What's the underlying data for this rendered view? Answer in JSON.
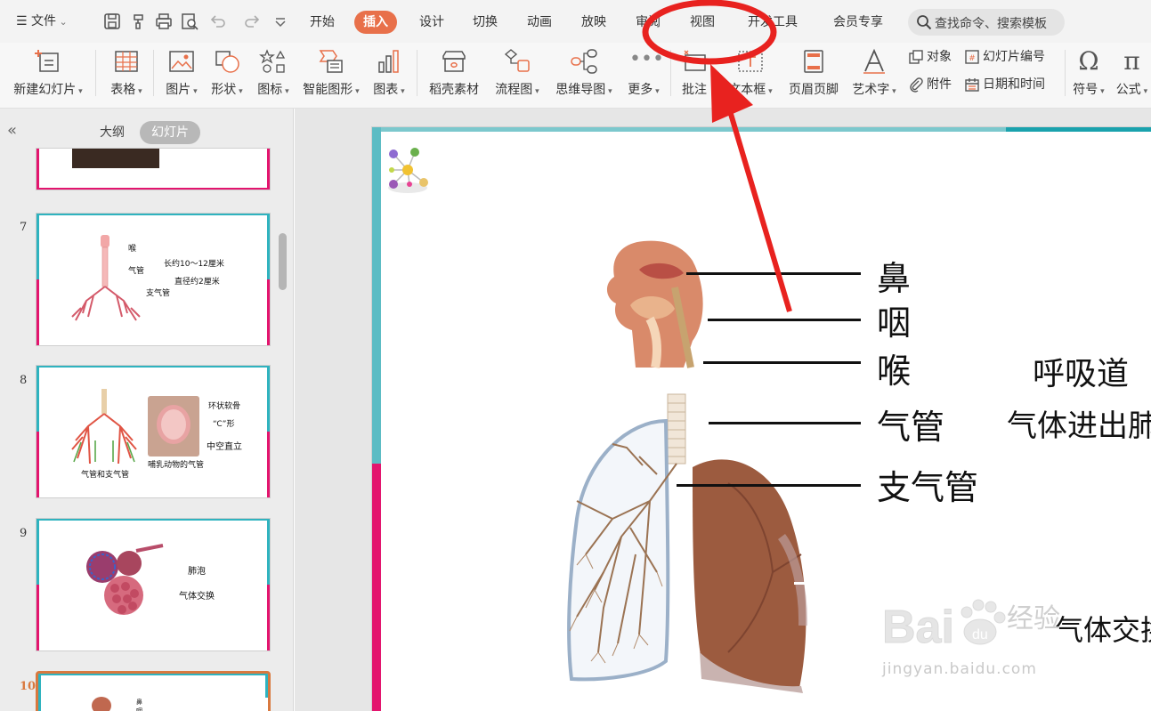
{
  "menubar": {
    "file_label": "文件",
    "tabs": [
      {
        "label": "开始",
        "active": false
      },
      {
        "label": "插入",
        "active": true
      },
      {
        "label": "设计",
        "active": false
      },
      {
        "label": "切换",
        "active": false
      },
      {
        "label": "动画",
        "active": false
      },
      {
        "label": "放映",
        "active": false
      },
      {
        "label": "审阅",
        "active": false
      },
      {
        "label": "视图",
        "active": false
      },
      {
        "label": "开发工具",
        "active": false
      },
      {
        "label": "会员专享",
        "active": false
      }
    ],
    "search_placeholder": "查找命令、搜索模板"
  },
  "ribbon": {
    "new_slide": "新建幻灯片",
    "table": "表格",
    "picture": "图片",
    "shape": "形状",
    "icon": "图标",
    "smart_graphic": "智能图形",
    "chart": "图表",
    "docer_material": "稻壳素材",
    "flowchart": "流程图",
    "mindmap": "思维导图",
    "more": "更多",
    "comment": "批注",
    "textbox": "文本框",
    "header_footer": "页眉页脚",
    "wordart": "艺术字",
    "object": "对象",
    "slide_number": "幻灯片编号",
    "attachment": "附件",
    "date_time": "日期和时间",
    "symbol": "符号",
    "formula": "公式"
  },
  "leftpanel": {
    "tab_outline": "大纲",
    "tab_slides": "幻灯片",
    "slides": [
      {
        "num": "7",
        "labels": [
          "喉",
          "气管",
          "支气管",
          "长约10～12厘米",
          "直径约2厘米"
        ]
      },
      {
        "num": "8",
        "labels": [
          "环状软骨",
          "“C”形",
          "中空直立",
          "气管和支气管",
          "哺乳动物的气管"
        ]
      },
      {
        "num": "9",
        "labels": [
          "肺泡",
          "气体交换"
        ]
      },
      {
        "num": "10",
        "labels": [
          "鼻",
          "咽"
        ]
      }
    ]
  },
  "slide": {
    "labels": {
      "nose": "鼻",
      "pharynx": "咽",
      "larynx": "喉",
      "trachea": "气管",
      "bronchus": "支气管",
      "respiratory_tract": "呼吸道",
      "gas_passage": "气体进出肺",
      "gas_exchange": "气体交换"
    },
    "watermark": "jingyan.baidu.com",
    "watermark_brand": "Baidu 经验"
  },
  "colors": {
    "active_tab": "#e8704a",
    "accent_teal": "#5cbcc4",
    "accent_pink": "#e3156e",
    "annotation_red": "#e8221f"
  }
}
